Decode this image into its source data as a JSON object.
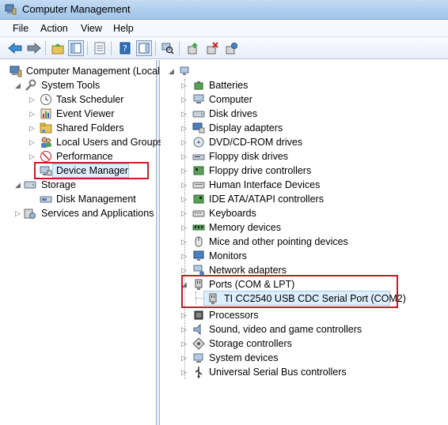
{
  "window": {
    "title": "Computer Management"
  },
  "menu": [
    "File",
    "Action",
    "View",
    "Help"
  ],
  "toolbar": [
    "back-icon",
    "forward-icon",
    "up-folder-icon",
    "show-hide-tree-icon",
    "properties-icon",
    "help-icon",
    "show-hide-action-pane-icon",
    "scan-hardware-icon",
    "update-driver-icon",
    "uninstall-device-icon",
    "enable-device-icon"
  ],
  "left_tree": {
    "root": "Computer Management (Local",
    "system_tools": "System Tools",
    "task_scheduler": "Task Scheduler",
    "event_viewer": "Event Viewer",
    "shared_folders": "Shared Folders",
    "local_users": "Local Users and Groups",
    "performance": "Performance",
    "device_manager": "Device Manager",
    "storage": "Storage",
    "disk_management": "Disk Management",
    "services": "Services and Applications"
  },
  "device_tree": {
    "categories": [
      "Batteries",
      "Computer",
      "Disk drives",
      "Display adapters",
      "DVD/CD-ROM drives",
      "Floppy disk drives",
      "Floppy drive controllers",
      "Human Interface Devices",
      "IDE ATA/ATAPI controllers",
      "Keyboards",
      "Memory devices",
      "Mice and other pointing devices",
      "Monitors",
      "Network adapters"
    ],
    "ports": "Ports (COM & LPT)",
    "port_device": "TI CC2540 USB CDC Serial Port (COM2)",
    "after": [
      "Processors",
      "Sound, video and game controllers",
      "Storage controllers",
      "System devices",
      "Universal Serial Bus controllers"
    ]
  },
  "colors": {
    "highlight": "#d01824",
    "selection": "#ddeefc"
  }
}
